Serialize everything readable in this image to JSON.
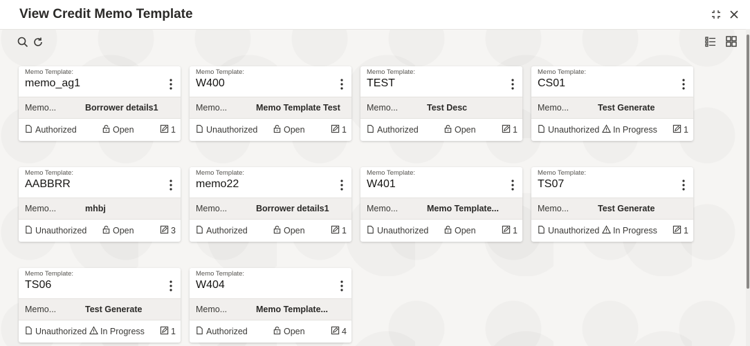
{
  "header": {
    "title": "View Credit Memo Template"
  },
  "icons": {
    "search": "search-icon",
    "refresh": "refresh-icon",
    "list_view": "list-view-icon",
    "grid_view": "grid-view-icon",
    "minimize": "minimize-icon",
    "close": "close-icon"
  },
  "colors": {
    "background": "#f6f5f3",
    "card": "#ffffff",
    "desc_row": "#f1efed"
  },
  "cards": [
    {
      "label": "Memo Template:",
      "name": "memo_ag1",
      "desc_key": "Memo...",
      "desc_val": "Borrower details1",
      "auth": "Authorized",
      "state": "Open",
      "count": "1"
    },
    {
      "label": "Memo Template:",
      "name": "W400",
      "desc_key": "Memo...",
      "desc_val": "Memo Template Test",
      "auth": "Unauthorized",
      "state": "Open",
      "count": "1"
    },
    {
      "label": "Memo Template:",
      "name": "TEST",
      "desc_key": "Memo...",
      "desc_val": "Test Desc",
      "auth": "Authorized",
      "state": "Open",
      "count": "1"
    },
    {
      "label": "Memo Template:",
      "name": "CS01",
      "desc_key": "Memo...",
      "desc_val": "Test Generate",
      "auth": "Unauthorized",
      "state": "In Progress",
      "count": "1"
    },
    {
      "label": "Memo Template:",
      "name": "AABBRR",
      "desc_key": "Memo...",
      "desc_val": "mhbj",
      "auth": "Unauthorized",
      "state": "Open",
      "count": "3"
    },
    {
      "label": "Memo Template:",
      "name": "memo22",
      "desc_key": "Memo...",
      "desc_val": "Borrower details1",
      "auth": "Authorized",
      "state": "Open",
      "count": "1"
    },
    {
      "label": "Memo Template:",
      "name": "W401",
      "desc_key": "Memo...",
      "desc_val": "Memo Template...",
      "auth": "Unauthorized",
      "state": "Open",
      "count": "1"
    },
    {
      "label": "Memo Template:",
      "name": "TS07",
      "desc_key": "Memo...",
      "desc_val": "Test Generate",
      "auth": "Unauthorized",
      "state": "In Progress",
      "count": "1"
    },
    {
      "label": "Memo Template:",
      "name": "TS06",
      "desc_key": "Memo...",
      "desc_val": "Test Generate",
      "auth": "Unauthorized",
      "state": "In Progress",
      "count": "1"
    },
    {
      "label": "Memo Template:",
      "name": "W404",
      "desc_key": "Memo...",
      "desc_val": "Memo Template...",
      "auth": "Authorized",
      "state": "Open",
      "count": "4"
    }
  ]
}
